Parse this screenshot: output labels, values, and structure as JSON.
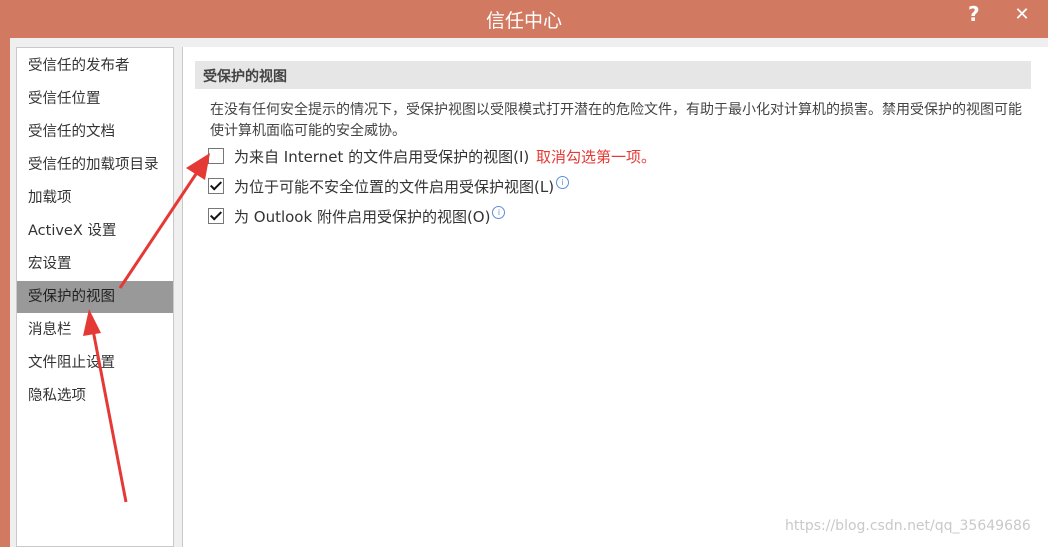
{
  "window": {
    "title": "信任中心",
    "help_label": "?",
    "close_label": "✕"
  },
  "sidebar": {
    "items": [
      {
        "label": "受信任的发布者"
      },
      {
        "label": "受信任位置"
      },
      {
        "label": "受信任的文档"
      },
      {
        "label": "受信任的加载项目录"
      },
      {
        "label": "加载项"
      },
      {
        "label": "ActiveX 设置"
      },
      {
        "label": "宏设置"
      },
      {
        "label": "受保护的视图",
        "active": true
      },
      {
        "label": "消息栏"
      },
      {
        "label": "文件阻止设置"
      },
      {
        "label": "隐私选项"
      }
    ]
  },
  "main": {
    "section_title": "受保护的视图",
    "description": "在没有任何安全提示的情况下，受保护视图以受限模式打开潜在的危险文件，有助于最小化对计算机的损害。禁用受保护的视图可能使计算机面临可能的安全威协。",
    "options": [
      {
        "label": "为来自 Internet 的文件启用受保护的视图(I)",
        "checked": false,
        "info_icon": false
      },
      {
        "label": "为位于可能不安全位置的文件启用受保护视图(L)",
        "checked": true,
        "info_icon": true
      },
      {
        "label": "为 Outlook 附件启用受保护的视图(O)",
        "checked": true,
        "info_icon": true
      }
    ]
  },
  "annotation": {
    "note": "取消勾选第一项。",
    "color": "#e53935"
  },
  "watermark": "https://blog.csdn.net/qq_35649686",
  "colors": {
    "titlebar": "#d27a61",
    "active_item": "#999999",
    "accent_red": "#e53935"
  }
}
